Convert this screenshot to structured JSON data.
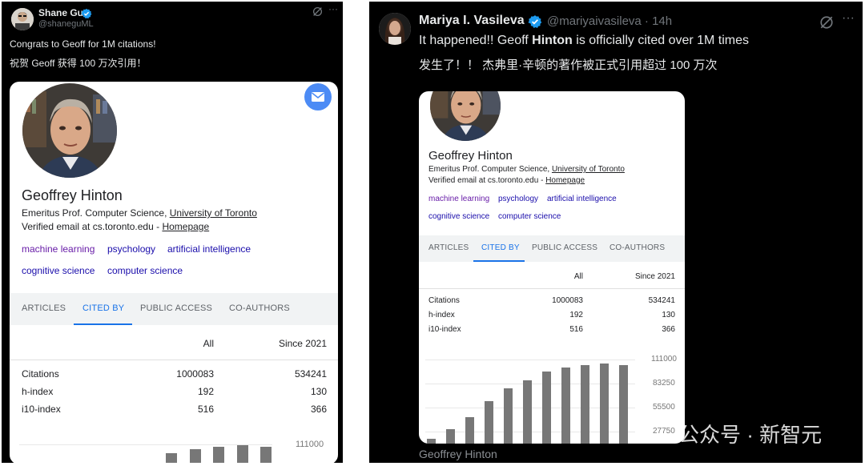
{
  "tweet_left": {
    "author_name": "Shane Gu",
    "author_handle": "@shaneguML",
    "text_line1": "Congrats to Geoff for 1M citations!",
    "text_line2": "祝贺 Geoff 获得 100 万次引用！"
  },
  "tweet_right": {
    "author_name": "Mariya I. Vasileva",
    "author_handle": "@mariyaivasileva · 14h",
    "text_line1_prefix": "It happened!! Geoff ",
    "text_line1_bold": "Hinton",
    "text_line1_suffix": " is officially cited over 1M times",
    "text_line2": "发生了！！ 杰弗里·辛顿的著作被正式引用超过 100 万次"
  },
  "profile": {
    "name": "Geoffrey Hinton",
    "affil_prefix": "Emeritus Prof. Computer Science, ",
    "affil_link": "University of Toronto",
    "email_prefix": "Verified email at cs.toronto.edu - ",
    "homepage": "Homepage",
    "tags": [
      "machine learning",
      "psychology",
      "artificial intelligence",
      "cognitive science",
      "computer science"
    ],
    "tabs": [
      "ARTICLES",
      "CITED BY",
      "PUBLIC ACCESS",
      "CO-AUTHORS"
    ],
    "col_all": "All",
    "col_since": "Since 2021",
    "rows": [
      {
        "label": "Citations",
        "all": "1000083",
        "since": "534241"
      },
      {
        "label": "h-index",
        "all": "192",
        "since": "130"
      },
      {
        "label": "i10-index",
        "all": "516",
        "since": "366"
      }
    ],
    "chart_ticks": [
      "111000",
      "83250",
      "55500",
      "27750"
    ],
    "chart_bars_relative": [
      0.06,
      0.17,
      0.31,
      0.5,
      0.66,
      0.75,
      0.86,
      0.9,
      0.93,
      0.95,
      0.93
    ]
  },
  "watermark": "公众号 · 新智元",
  "caption": "Geoffrey Hinton",
  "colors": {
    "tag_purple": "#681da8",
    "tag_blue": "#1a0dab",
    "active_tab": "#1a73e8",
    "verified": "#1d9bf0"
  }
}
